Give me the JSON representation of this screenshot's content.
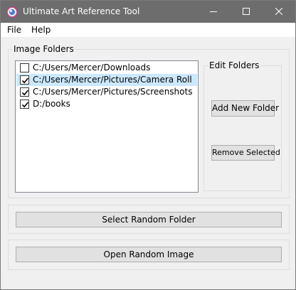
{
  "window": {
    "title": "Ultimate Art Reference Tool",
    "titlebar_color": "#6d6d6d",
    "icons": {
      "app": "app-icon",
      "minimize": "minimize-icon",
      "maximize": "maximize-icon",
      "close": "close-icon"
    }
  },
  "menu": {
    "items": [
      "File",
      "Help"
    ]
  },
  "image_folders": {
    "label": "Image Folders",
    "folders": [
      {
        "path": "C:/Users/Mercer/Downloads",
        "checked": false,
        "selected": false
      },
      {
        "path": "C:/Users/Mercer/Pictures/Camera Roll",
        "checked": true,
        "selected": true
      },
      {
        "path": "C:/Users/Mercer/Pictures/Screenshots",
        "checked": true,
        "selected": false
      },
      {
        "path": "D:/books",
        "checked": true,
        "selected": false
      }
    ],
    "selection_color": "#cce8ff"
  },
  "edit_folders": {
    "label": "Edit Folders",
    "add_label": "Add New Folder",
    "remove_label": "Remove Selected"
  },
  "actions": {
    "select_random_folder": "Select Random Folder",
    "open_random_image": "Open Random Image"
  }
}
